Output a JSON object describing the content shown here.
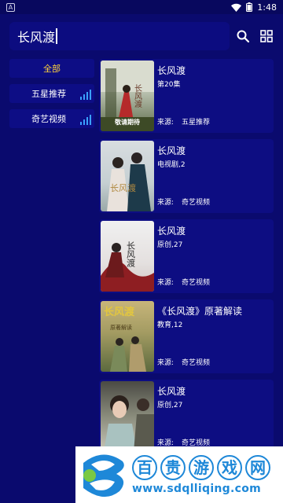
{
  "status_bar": {
    "app_icon_letter": "A",
    "time": "1:48"
  },
  "search": {
    "query": "长风渡"
  },
  "toolbar": {
    "search_icon": "search-icon",
    "grid_icon": "grid-icon"
  },
  "sidebar": {
    "items": [
      {
        "label": "全部",
        "active": true
      },
      {
        "label": "五星推荐",
        "active": false
      },
      {
        "label": "奇艺视频",
        "active": false
      }
    ]
  },
  "results": [
    {
      "title": "长风渡",
      "subtitle": "第20集",
      "source_label": "来源:",
      "source_value": "五星推荐",
      "thumb_caption": "敬请期待",
      "thumb_art": "长风渡"
    },
    {
      "title": "长风渡",
      "subtitle": "电视剧,2",
      "source_label": "来源:",
      "source_value": "奇艺视频",
      "thumb_art": "长风渡"
    },
    {
      "title": "长风渡",
      "subtitle": "原创,27",
      "source_label": "来源:",
      "source_value": "奇艺视频",
      "thumb_art": "长风渡"
    },
    {
      "title": "《长风渡》原著解读",
      "subtitle": "教育,12",
      "source_label": "来源:",
      "source_value": "奇艺视频",
      "thumb_art": "长风渡",
      "thumb_caption": "原著解读"
    },
    {
      "title": "长风渡",
      "subtitle": "原创,27",
      "source_label": "来源:",
      "source_value": "奇艺视频"
    }
  ],
  "watermark": {
    "chars": [
      "百",
      "贵",
      "游",
      "戏",
      "网"
    ],
    "url": "www.sdqlliqing.com"
  },
  "colors": {
    "background": "#0a0a6e",
    "card": "#0d0d82",
    "accent": "#ffd43b",
    "signal": "#3aa0ff"
  }
}
